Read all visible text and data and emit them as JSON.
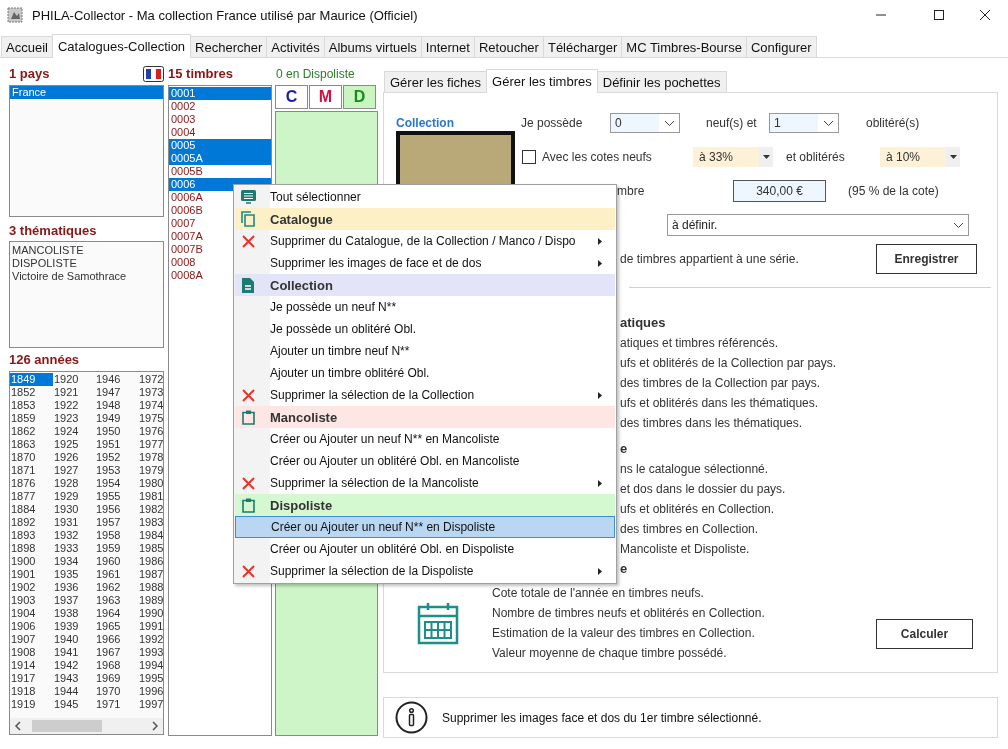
{
  "window": {
    "title": "PHILA-Collector - Ma collection France utilisé par Maurice (Officiel)"
  },
  "tabs": [
    {
      "label": "Accueil",
      "selected": false
    },
    {
      "label": "Catalogues-Collection",
      "selected": true
    },
    {
      "label": "Rechercher",
      "selected": false
    },
    {
      "label": "Activités",
      "selected": false
    },
    {
      "label": "Albums virtuels",
      "selected": false
    },
    {
      "label": "Internet",
      "selected": false
    },
    {
      "label": "Retoucher",
      "selected": false
    },
    {
      "label": "Télécharger",
      "selected": false
    },
    {
      "label": "MC Timbres-Bourse",
      "selected": false
    },
    {
      "label": "Configurer",
      "selected": false
    }
  ],
  "countries": {
    "heading": "1 pays",
    "items": [
      {
        "label": "France",
        "selected": true
      }
    ]
  },
  "themes": {
    "heading": "3 thématiques",
    "items": [
      {
        "label": "MANCOLISTE",
        "selected": false
      },
      {
        "label": "DISPOLISTE",
        "selected": false
      },
      {
        "label": "Victoire de Samothrace",
        "selected": false
      }
    ]
  },
  "years": {
    "heading": "126 années",
    "items": [
      {
        "label": "1849",
        "selected": true
      },
      {
        "label": "1852",
        "selected": false
      },
      {
        "label": "1853",
        "selected": false
      },
      {
        "label": "1859",
        "selected": false
      },
      {
        "label": "1862",
        "selected": false
      },
      {
        "label": "1863",
        "selected": false
      },
      {
        "label": "1870",
        "selected": false
      },
      {
        "label": "1871",
        "selected": false
      },
      {
        "label": "1876",
        "selected": false
      },
      {
        "label": "1877",
        "selected": false
      },
      {
        "label": "1884",
        "selected": false
      },
      {
        "label": "1892",
        "selected": false
      },
      {
        "label": "1893",
        "selected": false
      },
      {
        "label": "1898",
        "selected": false
      },
      {
        "label": "1900",
        "selected": false
      },
      {
        "label": "1901",
        "selected": false
      },
      {
        "label": "1902",
        "selected": false
      },
      {
        "label": "1903",
        "selected": false
      },
      {
        "label": "1904",
        "selected": false
      },
      {
        "label": "1906",
        "selected": false
      },
      {
        "label": "1907",
        "selected": false
      },
      {
        "label": "1908",
        "selected": false
      },
      {
        "label": "1914",
        "selected": false
      },
      {
        "label": "1917",
        "selected": false
      },
      {
        "label": "1918",
        "selected": false
      },
      {
        "label": "1919",
        "selected": false
      },
      {
        "label": "1920",
        "selected": false
      },
      {
        "label": "1921",
        "selected": false
      },
      {
        "label": "1922",
        "selected": false
      },
      {
        "label": "1923",
        "selected": false
      },
      {
        "label": "1924",
        "selected": false
      },
      {
        "label": "1925",
        "selected": false
      },
      {
        "label": "1926",
        "selected": false
      },
      {
        "label": "1927",
        "selected": false
      },
      {
        "label": "1928",
        "selected": false
      },
      {
        "label": "1929",
        "selected": false
      },
      {
        "label": "1930",
        "selected": false
      },
      {
        "label": "1931",
        "selected": false
      },
      {
        "label": "1932",
        "selected": false
      },
      {
        "label": "1933",
        "selected": false
      },
      {
        "label": "1934",
        "selected": false
      },
      {
        "label": "1935",
        "selected": false
      },
      {
        "label": "1936",
        "selected": false
      },
      {
        "label": "1937",
        "selected": false
      },
      {
        "label": "1938",
        "selected": false
      },
      {
        "label": "1939",
        "selected": false
      },
      {
        "label": "1940",
        "selected": false
      },
      {
        "label": "1941",
        "selected": false
      },
      {
        "label": "1942",
        "selected": false
      },
      {
        "label": "1943",
        "selected": false
      },
      {
        "label": "1944",
        "selected": false
      },
      {
        "label": "1945",
        "selected": false
      },
      {
        "label": "1946",
        "selected": false
      },
      {
        "label": "1947",
        "selected": false
      },
      {
        "label": "1948",
        "selected": false
      },
      {
        "label": "1949",
        "selected": false
      },
      {
        "label": "1950",
        "selected": false
      },
      {
        "label": "1951",
        "selected": false
      },
      {
        "label": "1952",
        "selected": false
      },
      {
        "label": "1953",
        "selected": false
      },
      {
        "label": "1954",
        "selected": false
      },
      {
        "label": "1955",
        "selected": false
      },
      {
        "label": "1956",
        "selected": false
      },
      {
        "label": "1957",
        "selected": false
      },
      {
        "label": "1958",
        "selected": false
      },
      {
        "label": "1959",
        "selected": false
      },
      {
        "label": "1960",
        "selected": false
      },
      {
        "label": "1961",
        "selected": false
      },
      {
        "label": "1962",
        "selected": false
      },
      {
        "label": "1963",
        "selected": false
      },
      {
        "label": "1964",
        "selected": false
      },
      {
        "label": "1965",
        "selected": false
      },
      {
        "label": "1966",
        "selected": false
      },
      {
        "label": "1967",
        "selected": false
      },
      {
        "label": "1968",
        "selected": false
      },
      {
        "label": "1969",
        "selected": false
      },
      {
        "label": "1970",
        "selected": false
      },
      {
        "label": "1971",
        "selected": false
      },
      {
        "label": "1972",
        "selected": false
      },
      {
        "label": "1973",
        "selected": false
      },
      {
        "label": "1974",
        "selected": false
      },
      {
        "label": "1975",
        "selected": false
      },
      {
        "label": "1976",
        "selected": false
      },
      {
        "label": "1977",
        "selected": false
      },
      {
        "label": "1978",
        "selected": false
      },
      {
        "label": "1979",
        "selected": false
      },
      {
        "label": "1980",
        "selected": false
      },
      {
        "label": "1981",
        "selected": false
      },
      {
        "label": "1982",
        "selected": false
      },
      {
        "label": "1983",
        "selected": false
      },
      {
        "label": "1984",
        "selected": false
      },
      {
        "label": "1985",
        "selected": false
      },
      {
        "label": "1986",
        "selected": false
      },
      {
        "label": "1987",
        "selected": false
      },
      {
        "label": "1988",
        "selected": false
      },
      {
        "label": "1989",
        "selected": false
      },
      {
        "label": "1990",
        "selected": false
      },
      {
        "label": "1991",
        "selected": false
      },
      {
        "label": "1992",
        "selected": false
      },
      {
        "label": "1993",
        "selected": false
      },
      {
        "label": "1994",
        "selected": false
      },
      {
        "label": "1995",
        "selected": false
      },
      {
        "label": "1996",
        "selected": false
      },
      {
        "label": "1997",
        "selected": false
      }
    ]
  },
  "stamps": {
    "heading": "15 timbres",
    "items": [
      {
        "label": "0001",
        "selected": true
      },
      {
        "label": "0002",
        "selected": false
      },
      {
        "label": "0003",
        "selected": false
      },
      {
        "label": "0004",
        "selected": false
      },
      {
        "label": "0005",
        "selected": true
      },
      {
        "label": "0005A",
        "selected": true
      },
      {
        "label": "0005B",
        "selected": false
      },
      {
        "label": "0006",
        "selected": true
      },
      {
        "label": "0006A",
        "selected": false
      },
      {
        "label": "0006B",
        "selected": false
      },
      {
        "label": "0007",
        "selected": false
      },
      {
        "label": "0007A",
        "selected": false
      },
      {
        "label": "0007B",
        "selected": false
      },
      {
        "label": "0008",
        "selected": false
      },
      {
        "label": "0008A",
        "selected": false
      }
    ]
  },
  "dispo": {
    "heading": "0 en Dispoliste",
    "buttons": [
      {
        "label": "C",
        "color": "#1c1ca8",
        "selected": false
      },
      {
        "label": "M",
        "color": "#d4103c",
        "selected": false
      },
      {
        "label": "D",
        "color": "#1a8a1a",
        "selected": true
      }
    ]
  },
  "subtabs": [
    {
      "label": "Gérer les fiches",
      "selected": false
    },
    {
      "label": "Gérer les timbres",
      "selected": true
    },
    {
      "label": "Définir les pochettes",
      "selected": false
    }
  ],
  "form": {
    "collection_label": "Collection",
    "own_label": "Je possède",
    "new_count": "0",
    "new_label": "neuf(s) et",
    "used_count": "1",
    "used_label": "oblitéré(s)",
    "ratings": {
      "label": "Avec les cotes neufs",
      "checked": false
    },
    "new_rate": "à 33%",
    "used_rate_label": "et oblitérés",
    "used_rate": "à 10%",
    "price_label": "mbre",
    "price": "340,00 €",
    "price_note": "(95 % de la cote)",
    "series": "à définir.",
    "series_note": "de timbres appartient à une série.",
    "save": "Enregistrer"
  },
  "sections": [
    {
      "heading": "atiques",
      "lines": [
        "atiques et timbres référencés.",
        "ufs et oblitérés de la Collection par pays.",
        "des timbres de la Collection par pays.",
        "ufs et oblitérés dans les thématiques.",
        "des timbres dans les thématiques."
      ]
    },
    {
      "heading": "e",
      "lines": [
        "ns le catalogue sélectionné.",
        "et dos dans le dossier du pays.",
        "ufs et oblitérés en Collection.",
        "des timbres en Collection.",
        "Mancoliste et Dispoliste."
      ]
    }
  ],
  "year_section": {
    "heading": "e",
    "lines": [
      "Cote totale de l'année en timbres neufs.",
      "Nombre de timbres neufs et oblitérés en Collection.",
      "Estimation de la valeur des timbres en Collection.",
      "Valeur moyenne de chaque timbre possédé."
    ],
    "button": "Calculer"
  },
  "menu": [
    {
      "kind": "select_all",
      "label": "Tout sélectionner",
      "submenu": false,
      "selected": false
    },
    {
      "kind": "catalogue_header",
      "label": "Catalogue",
      "color": "#fdf0c6"
    },
    {
      "kind": "delete",
      "label": "Supprimer du Catalogue, de la Collection / Manco / Dispo",
      "submenu": true,
      "selected": false
    },
    {
      "kind": "item",
      "label": "Supprimer les images de face et de dos",
      "submenu": true,
      "selected": false
    },
    {
      "kind": "collection_header",
      "label": "Collection",
      "color": "#e4e4f8"
    },
    {
      "kind": "item",
      "label": "Je possède un neuf N**",
      "submenu": false,
      "selected": false
    },
    {
      "kind": "item",
      "label": "Je possède un oblitéré Obl.",
      "submenu": false,
      "selected": false
    },
    {
      "kind": "item",
      "label": "Ajouter un timbre neuf N**",
      "submenu": false,
      "selected": false
    },
    {
      "kind": "item",
      "label": "Ajouter un timbre oblitéré Obl.",
      "submenu": false,
      "selected": false
    },
    {
      "kind": "delete",
      "label": "Supprimer la sélection de la Collection",
      "submenu": true,
      "selected": false
    },
    {
      "kind": "list_header",
      "label": "Mancoliste",
      "color": "#fde6e4"
    },
    {
      "kind": "item",
      "label": "Créer ou Ajouter un neuf N** en Mancoliste",
      "submenu": false,
      "selected": false
    },
    {
      "kind": "item",
      "label": "Créer ou Ajouter un oblitéré Obl. en Mancoliste",
      "submenu": false,
      "selected": false
    },
    {
      "kind": "delete",
      "label": "Supprimer la sélection de la Mancoliste",
      "submenu": true,
      "selected": false
    },
    {
      "kind": "list_header",
      "label": "Dispoliste",
      "color": "#d4f8d0"
    },
    {
      "kind": "item",
      "label": "Créer ou Ajouter un neuf N** en Dispoliste",
      "submenu": false,
      "selected": true
    },
    {
      "kind": "item",
      "label": "Créer ou Ajouter un oblitéré Obl. en Dispoliste",
      "submenu": false,
      "selected": false
    },
    {
      "kind": "delete",
      "label": "Supprimer la sélection de la Dispoliste",
      "submenu": true,
      "selected": false
    }
  ],
  "info": "Supprimer les images face et dos du 1er timbre sélectionné."
}
